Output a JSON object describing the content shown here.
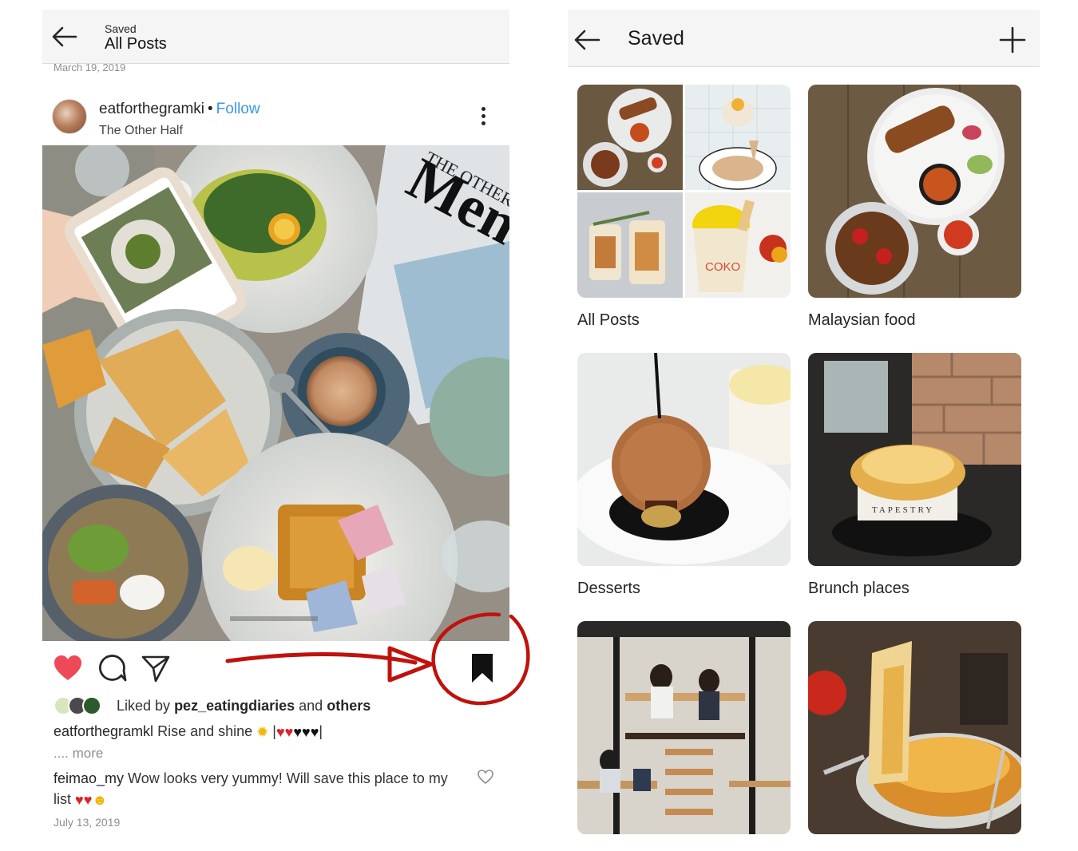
{
  "left_panel": {
    "header": {
      "subtitle": "Saved",
      "title": "All Posts"
    },
    "top_date": "March 19, 2019",
    "post": {
      "username": "eatforthegramki",
      "separator": "•",
      "follow_label": "Follow",
      "location": "The Other Half",
      "photo_text": {
        "magazine_title": "Menu",
        "magazine_brand": "THE OTHER",
        "cup_label": ""
      },
      "liked_by_prefix": "Liked by",
      "liked_by_user": "pez_eatingdiaries",
      "liked_by_and": "and",
      "liked_by_others": "others",
      "caption_user": "eatforthegramkl",
      "caption_text": "Rise and shine",
      "more_label": ".... more",
      "comment_user": "feimao_my",
      "comment_text": "Wow looks very yummy! Will save this place to my list",
      "post_date": "July 13, 2019"
    },
    "icons": [
      "back-arrow-icon",
      "more-vertical-icon",
      "heart-icon",
      "comment-icon",
      "share-icon",
      "bookmark-icon",
      "small-heart-icon"
    ],
    "annotation_color": "#c0120c"
  },
  "right_panel": {
    "header": {
      "title": "Saved"
    },
    "icons": [
      "back-arrow-icon",
      "plus-icon"
    ],
    "collections": [
      {
        "name": "All Posts"
      },
      {
        "name": "Malaysian food"
      },
      {
        "name": "Desserts"
      },
      {
        "name": "Brunch places"
      },
      {
        "name": ""
      },
      {
        "name": ""
      }
    ],
    "image_text": {
      "coko": "COKO",
      "tapestry": "TAPESTRY"
    }
  },
  "colors": {
    "like_red": "#ed4956",
    "link_blue": "#3897f0",
    "header_bg": "#f5f5f5"
  }
}
